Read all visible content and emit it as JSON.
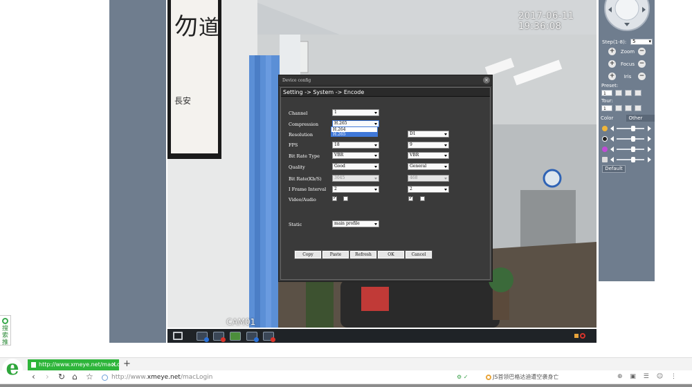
{
  "video": {
    "timestamp": "2017-06-11 19:36:08",
    "camera_label": "CAM01"
  },
  "ptz": {
    "step_label": "Step(1-8):",
    "step_value": "5",
    "zoom_label": "Zoom",
    "focus_label": "Focus",
    "iris_label": "Iris",
    "preset_label": "Preset:",
    "preset_value": "1",
    "tour_label": "Tour:",
    "tour_value": "1",
    "tabs": [
      "Color",
      "Other"
    ],
    "default_label": "Default",
    "slider_levels": [
      0.6,
      0.6,
      0.6,
      0.6
    ]
  },
  "dialog": {
    "title": "Device config",
    "breadcrumb": "Setting -> System -> Encode",
    "labels": {
      "channel": "Channel",
      "compression": "Compression",
      "resolution": "Resolution",
      "fps": "FPS",
      "bit_rate_type": "Bit Rate Type",
      "quality": "Quality",
      "bit_rate": "Bit Rate(Kb/S)",
      "i_frame_interval": "I Frame Interval",
      "video_audio": "Video/Audio",
      "static": "Static"
    },
    "main": {
      "channel": "1",
      "compression": "H.265",
      "fps": "18",
      "bit_rate_type": "VBR",
      "quality": "Good",
      "bit_rate": "3045",
      "i_frame_interval": "2",
      "static": "main profile"
    },
    "extra": {
      "resolution": "D1",
      "fps": "9",
      "bit_rate_type": "VBR",
      "quality": "General",
      "bit_rate": "468",
      "i_frame_interval": "2"
    },
    "compression_options": [
      "H.264",
      "H.265"
    ],
    "buttons": {
      "copy": "Copy",
      "paste": "Paste",
      "refresh": "Refresh",
      "ok": "OK",
      "cancel": "Cancel"
    }
  },
  "browser": {
    "tab_title": "http://www.xmeye.net/macLog",
    "url_prefix": "http://www.",
    "url_domain": "xmeye.net",
    "url_path": "/macLogin",
    "search_text": "JS首领巴格达迪遭空袭身亡",
    "side_widget_text": "搜索推"
  }
}
